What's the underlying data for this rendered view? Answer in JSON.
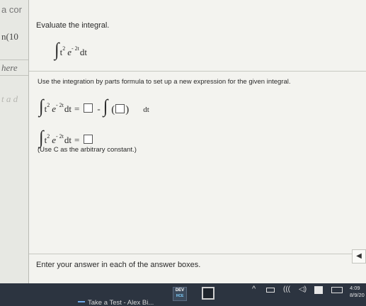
{
  "sidebar": {
    "fragments": [
      "a cor",
      "n(10",
      "here",
      "t a d"
    ]
  },
  "question": {
    "title": "Evaluate the integral.",
    "given": {
      "base": "t",
      "power": "2",
      "e": "e",
      "exponent": "- 2t",
      "differential": "dt"
    }
  },
  "parts": {
    "instruction": "Use the integration by parts formula to set up a new expression for the given integral.",
    "equals": "=",
    "minus": "-",
    "differential": "dt",
    "note": "(Use C as the arbitrary constant.)"
  },
  "footer": {
    "text": "Enter your answer in each of the answer boxes.",
    "arrow": "◀"
  },
  "taskbar": {
    "task_label": "Take a Test - Alex Bi...",
    "dev_app": "DEV",
    "dev_app_sub": "HCE",
    "time": "4:09",
    "date": "8/9/20"
  },
  "icons": {
    "tray_chevron": "^",
    "wifi": "(((",
    "volume": "◁)"
  }
}
